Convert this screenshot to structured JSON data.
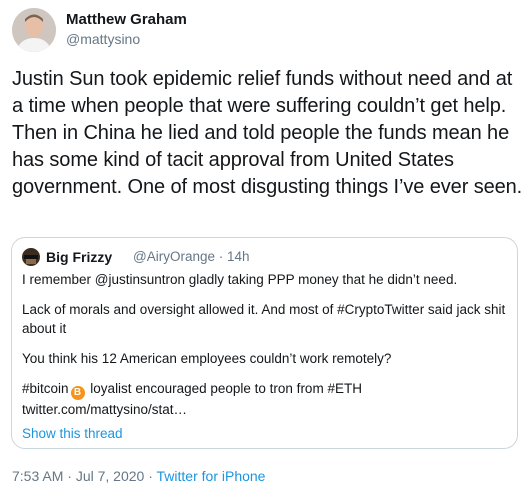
{
  "author": {
    "name": "Matthew Graham",
    "handle": "@mattysino"
  },
  "tweet": {
    "text": "Justin Sun took epidemic relief funds without need and at a time when people that were suffering couldn’t get help. Then in China he lied and told people the funds mean he has some kind of tacit approval from United States government. One of most disgusting things I’ve ever seen."
  },
  "quote": {
    "name": "Big Frizzy",
    "handle": "@AiryOrange",
    "separator": "·",
    "time": "14h",
    "paragraphs": [
      "I remember @justinsuntron gladly taking PPP money that he didn’t need.",
      "Lack of morals and oversight allowed it. And most of #CryptoTwitter said jack shit about it",
      "You think his 12 American employees couldn’t work remotely?"
    ],
    "last_line_before_icon": "#bitcoin",
    "last_line_after_icon": " loyalist encouraged people to tron from #ETH",
    "link": "twitter.com/mattysino/stat…",
    "show_thread": "Show this thread",
    "btc_symbol": "B",
    "btc_color": "#f7931a"
  },
  "footer": {
    "time": "7:53 AM",
    "separator1": " · ",
    "date": "Jul 7, 2020",
    "separator2": " · ",
    "source": "Twitter for iPhone"
  },
  "colors": {
    "text": "#14171a",
    "secondary": "#657786",
    "link": "#1b95e0",
    "border": "#ccd6dd"
  }
}
